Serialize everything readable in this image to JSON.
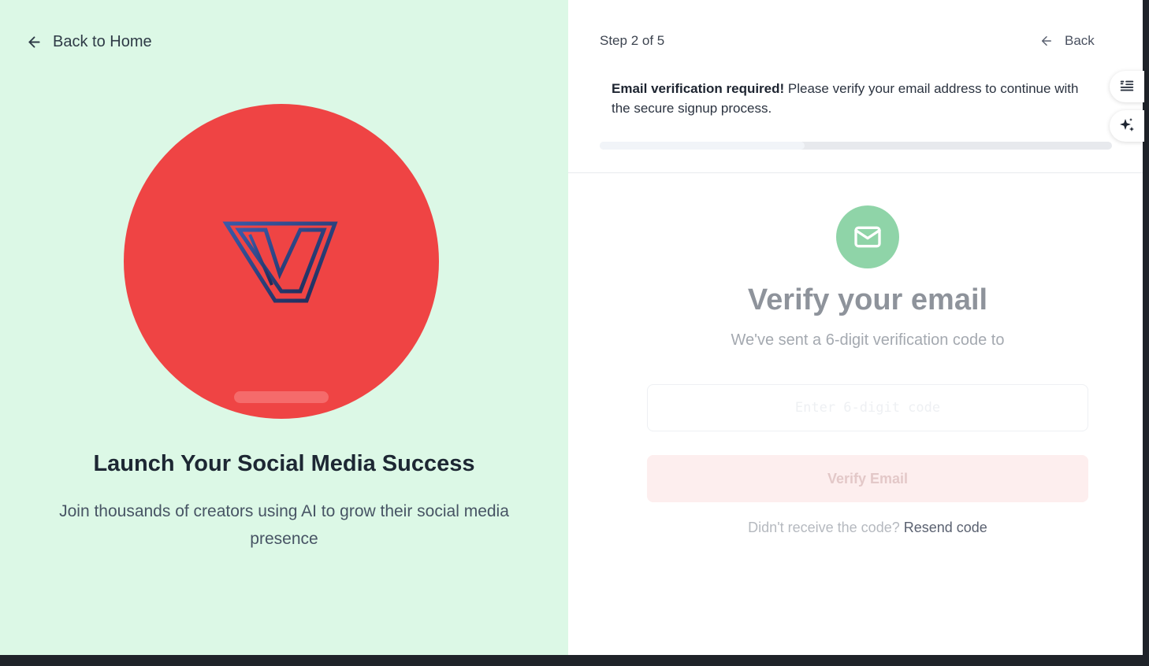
{
  "left": {
    "back_home_label": "Back to Home",
    "hero_title": "Launch Your Social Media Success",
    "hero_subtitle": "Join thousands of creators using AI to grow their social media presence",
    "brand_color": "#ef4444"
  },
  "header": {
    "step_label": "Step 2 of 5",
    "back_label": "Back",
    "notice_bold": "Email verification required!",
    "notice_text": " Please verify your email address to continue with the secure signup process.",
    "progress_percent": 40
  },
  "verify": {
    "title": "Verify your email",
    "subtitle": "We've sent a 6-digit verification code to",
    "code_placeholder": "Enter 6-digit code",
    "code_value": "",
    "button_label": "Verify Email",
    "resend_prompt": "Didn't receive the code? ",
    "resend_link": "Resend code"
  },
  "side_tools": {
    "tool1_icon": "quote-list-icon",
    "tool2_icon": "sparkle-icon"
  },
  "colors": {
    "left_bg": "#dcf8e6",
    "mail_badge": "#8fd4a8"
  }
}
